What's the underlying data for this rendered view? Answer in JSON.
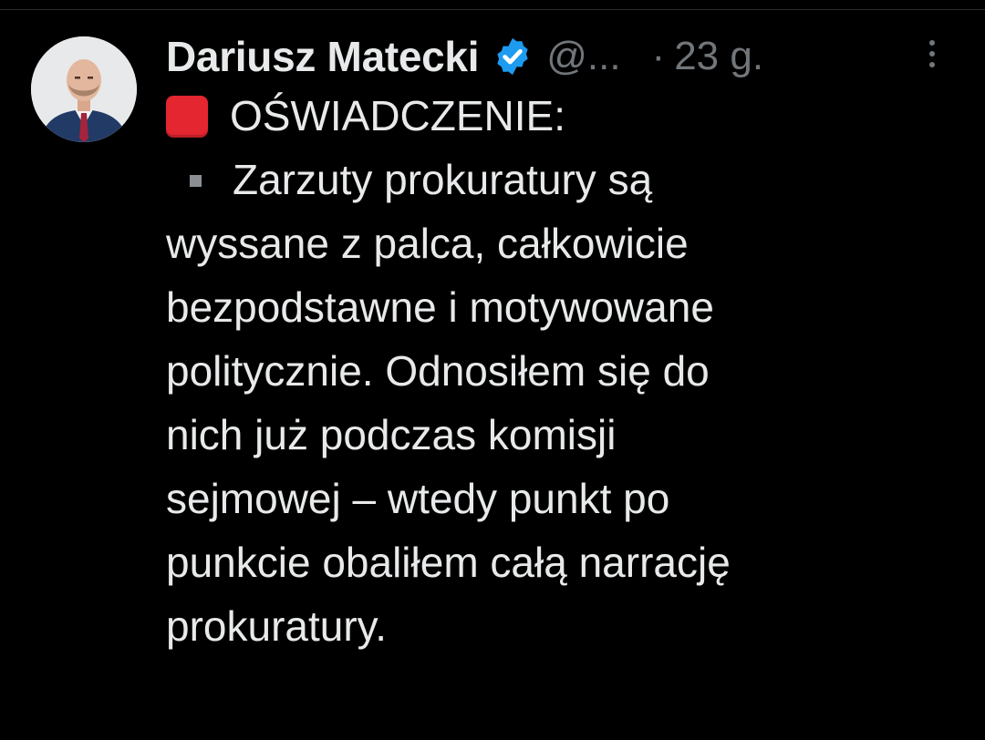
{
  "tweet": {
    "author_name": "Dariusz Matecki",
    "handle": "@...",
    "separator": "·",
    "time": "23 g.",
    "heading": "OŚWIADCZENIE:",
    "lines": [
      "Zarzuty prokuratury są",
      "wyssane z palca, całkowicie",
      "bezpodstawne i motywowane",
      "politycznie. Odnosiłem się do",
      "nich już podczas komisji",
      "sejmowej – wtedy punkt po",
      "punkcie obaliłem całą narrację",
      "prokuratury."
    ]
  },
  "icons": {
    "verified": "verified-badge-icon",
    "more": "more-options-icon",
    "heading_emoji": "red-square-emoji",
    "bullet": "small-square-bullet-icon"
  },
  "colors": {
    "background": "#000000",
    "text_primary": "#e7e9ea",
    "text_secondary": "#71767b",
    "verified_blue": "#1d9bf0",
    "red_square": "#e3262f"
  }
}
